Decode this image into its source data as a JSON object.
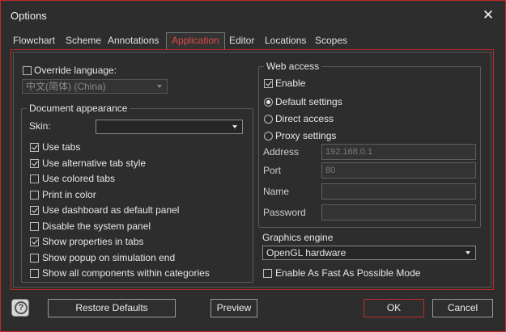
{
  "window": {
    "title": "Options"
  },
  "tabs": [
    {
      "label": "Flowchart"
    },
    {
      "label": "Scheme"
    },
    {
      "label": "Annotations"
    },
    {
      "label": "Application",
      "active": true
    },
    {
      "label": "Editor"
    },
    {
      "label": "Locations"
    },
    {
      "label": "Scopes"
    }
  ],
  "language": {
    "override_label": "Override language:",
    "override_checked": false,
    "selected": "中文(简体) (China)"
  },
  "document_appearance": {
    "legend": "Document appearance",
    "skin_label": "Skin:",
    "skin_value": "",
    "options": [
      {
        "label": "Use tabs",
        "checked": true
      },
      {
        "label": "Use alternative tab style",
        "checked": true
      },
      {
        "label": "Use colored tabs",
        "checked": false
      },
      {
        "label": "Print in color",
        "checked": false
      },
      {
        "label": "Use dashboard as default panel",
        "checked": true
      },
      {
        "label": "Disable the system panel",
        "checked": false
      },
      {
        "label": "Show properties in tabs",
        "checked": true
      },
      {
        "label": "Show popup on simulation end",
        "checked": false
      },
      {
        "label": "Show all components within categories",
        "checked": false
      }
    ]
  },
  "web_access": {
    "legend": "Web access",
    "enable_label": "Enable",
    "enable_checked": true,
    "radios": [
      {
        "label": "Default settings",
        "selected": true
      },
      {
        "label": "Direct access",
        "selected": false
      },
      {
        "label": "Proxy settings",
        "selected": false
      }
    ],
    "address_label": "Address",
    "address_placeholder": "192.168.0.1",
    "port_label": "Port",
    "port_placeholder": "80",
    "name_label": "Name",
    "name_value": "",
    "password_label": "Password",
    "password_value": ""
  },
  "graphics": {
    "label": "Graphics engine",
    "selected": "OpenGL hardware",
    "fast_mode_label": "Enable As Fast As Possible Mode",
    "fast_mode_checked": false
  },
  "buttons": {
    "help_icon": "question-icon",
    "restore_defaults": "Restore Defaults",
    "preview": "Preview",
    "ok": "OK",
    "cancel": "Cancel"
  },
  "colors": {
    "accent": "#c22a2a",
    "active_tab_text": "#e04848",
    "background": "#2d2d2d"
  }
}
